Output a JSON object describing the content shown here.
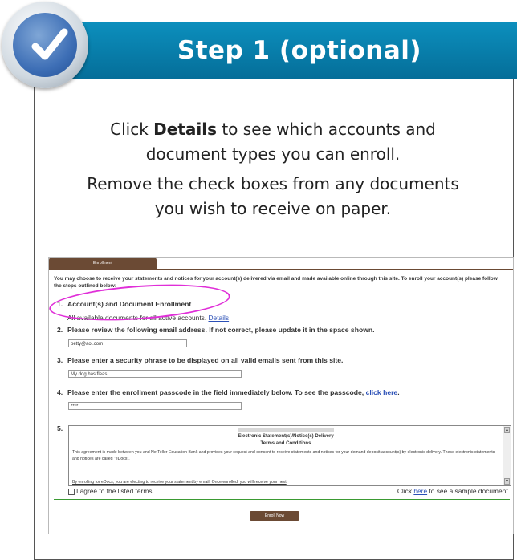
{
  "header": {
    "title": "Step 1 (optional)",
    "accent": "#0a86b4"
  },
  "instructions": {
    "line1_pre": "Click ",
    "line1_bold": "Details",
    "line1_post": " to see which accounts and",
    "line2": "document types you can enroll.",
    "line3": "Remove the check boxes from any documents",
    "line4": "you wish to receive on paper."
  },
  "enrollment": {
    "tab_label": "Enrollment",
    "intro": "You may choose to receive your statements and notices for your account(s) delivered via email and made available online through this site. To enroll your account(s) please follow the steps outlined below:",
    "steps": [
      {
        "num": "1.",
        "title": "Account(s) and Document Enrollment",
        "sub_text": "All available documents for all active accounts. ",
        "sub_link": "Details"
      },
      {
        "num": "2.",
        "title": "Please review the following email address. If not correct, please update it in the space shown.",
        "field_value": "betty@aol.com"
      },
      {
        "num": "3.",
        "title": "Please enter a security phrase to be displayed on all valid emails sent from this site.",
        "field_value": "My dog has fleas"
      },
      {
        "num": "4.",
        "title": "Please enter the enrollment passcode in the field immediately below. To see the passcode, ",
        "link": "click here",
        "after": ".",
        "field_value": "****"
      },
      {
        "num": "5."
      }
    ],
    "terms": {
      "title_line1": "Electronic Statement(s)/Notice(s) Delivery",
      "title_line2": "Terms and Conditions",
      "body": "This agreement is made between you and NetTeller Education Bank and provides your request and consent to receive statements and notices for your demand deposit account(s) by electronic delivery. These electronic statements and notices are called \"eDocs\".",
      "more": "By enrolling for eDocs, you are electing to receive your statement by email. Once enrolled, you will receive your next"
    },
    "agree_label": "I agree to the listed terms.",
    "sample_pre": "Click ",
    "sample_link": "here",
    "sample_post": " to see a sample document.",
    "enroll_button": "Enroll Now"
  }
}
